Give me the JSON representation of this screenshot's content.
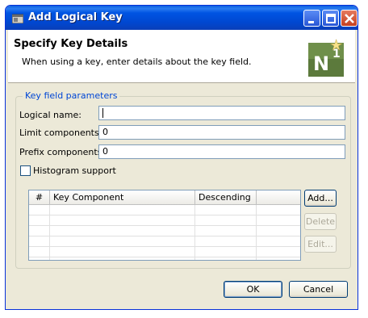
{
  "window": {
    "title": "Add Logical Key"
  },
  "header": {
    "title": "Specify Key Details",
    "description": "When using a key, enter details about the key field.",
    "logo_icon": "n1-wizard-icon"
  },
  "group": {
    "legend": "Key field parameters",
    "fields": {
      "logical_name": {
        "label": "Logical name:",
        "value": ""
      },
      "limit_components": {
        "label": "Limit components:",
        "value": "0"
      },
      "prefix_components": {
        "label": "Prefix components:",
        "value": "0"
      }
    },
    "histogram": {
      "label": "Histogram support",
      "checked": false
    },
    "table": {
      "columns": [
        "#",
        "Key Component",
        "Descending"
      ],
      "rows": []
    },
    "buttons": {
      "add": "Add...",
      "delete": "Delete",
      "edit": "Edit..."
    }
  },
  "footer": {
    "ok": "OK",
    "cancel": "Cancel"
  },
  "colors": {
    "titlebar": "#0054e3",
    "legend": "#0046d5",
    "dialog_bg": "#ece9d8"
  }
}
